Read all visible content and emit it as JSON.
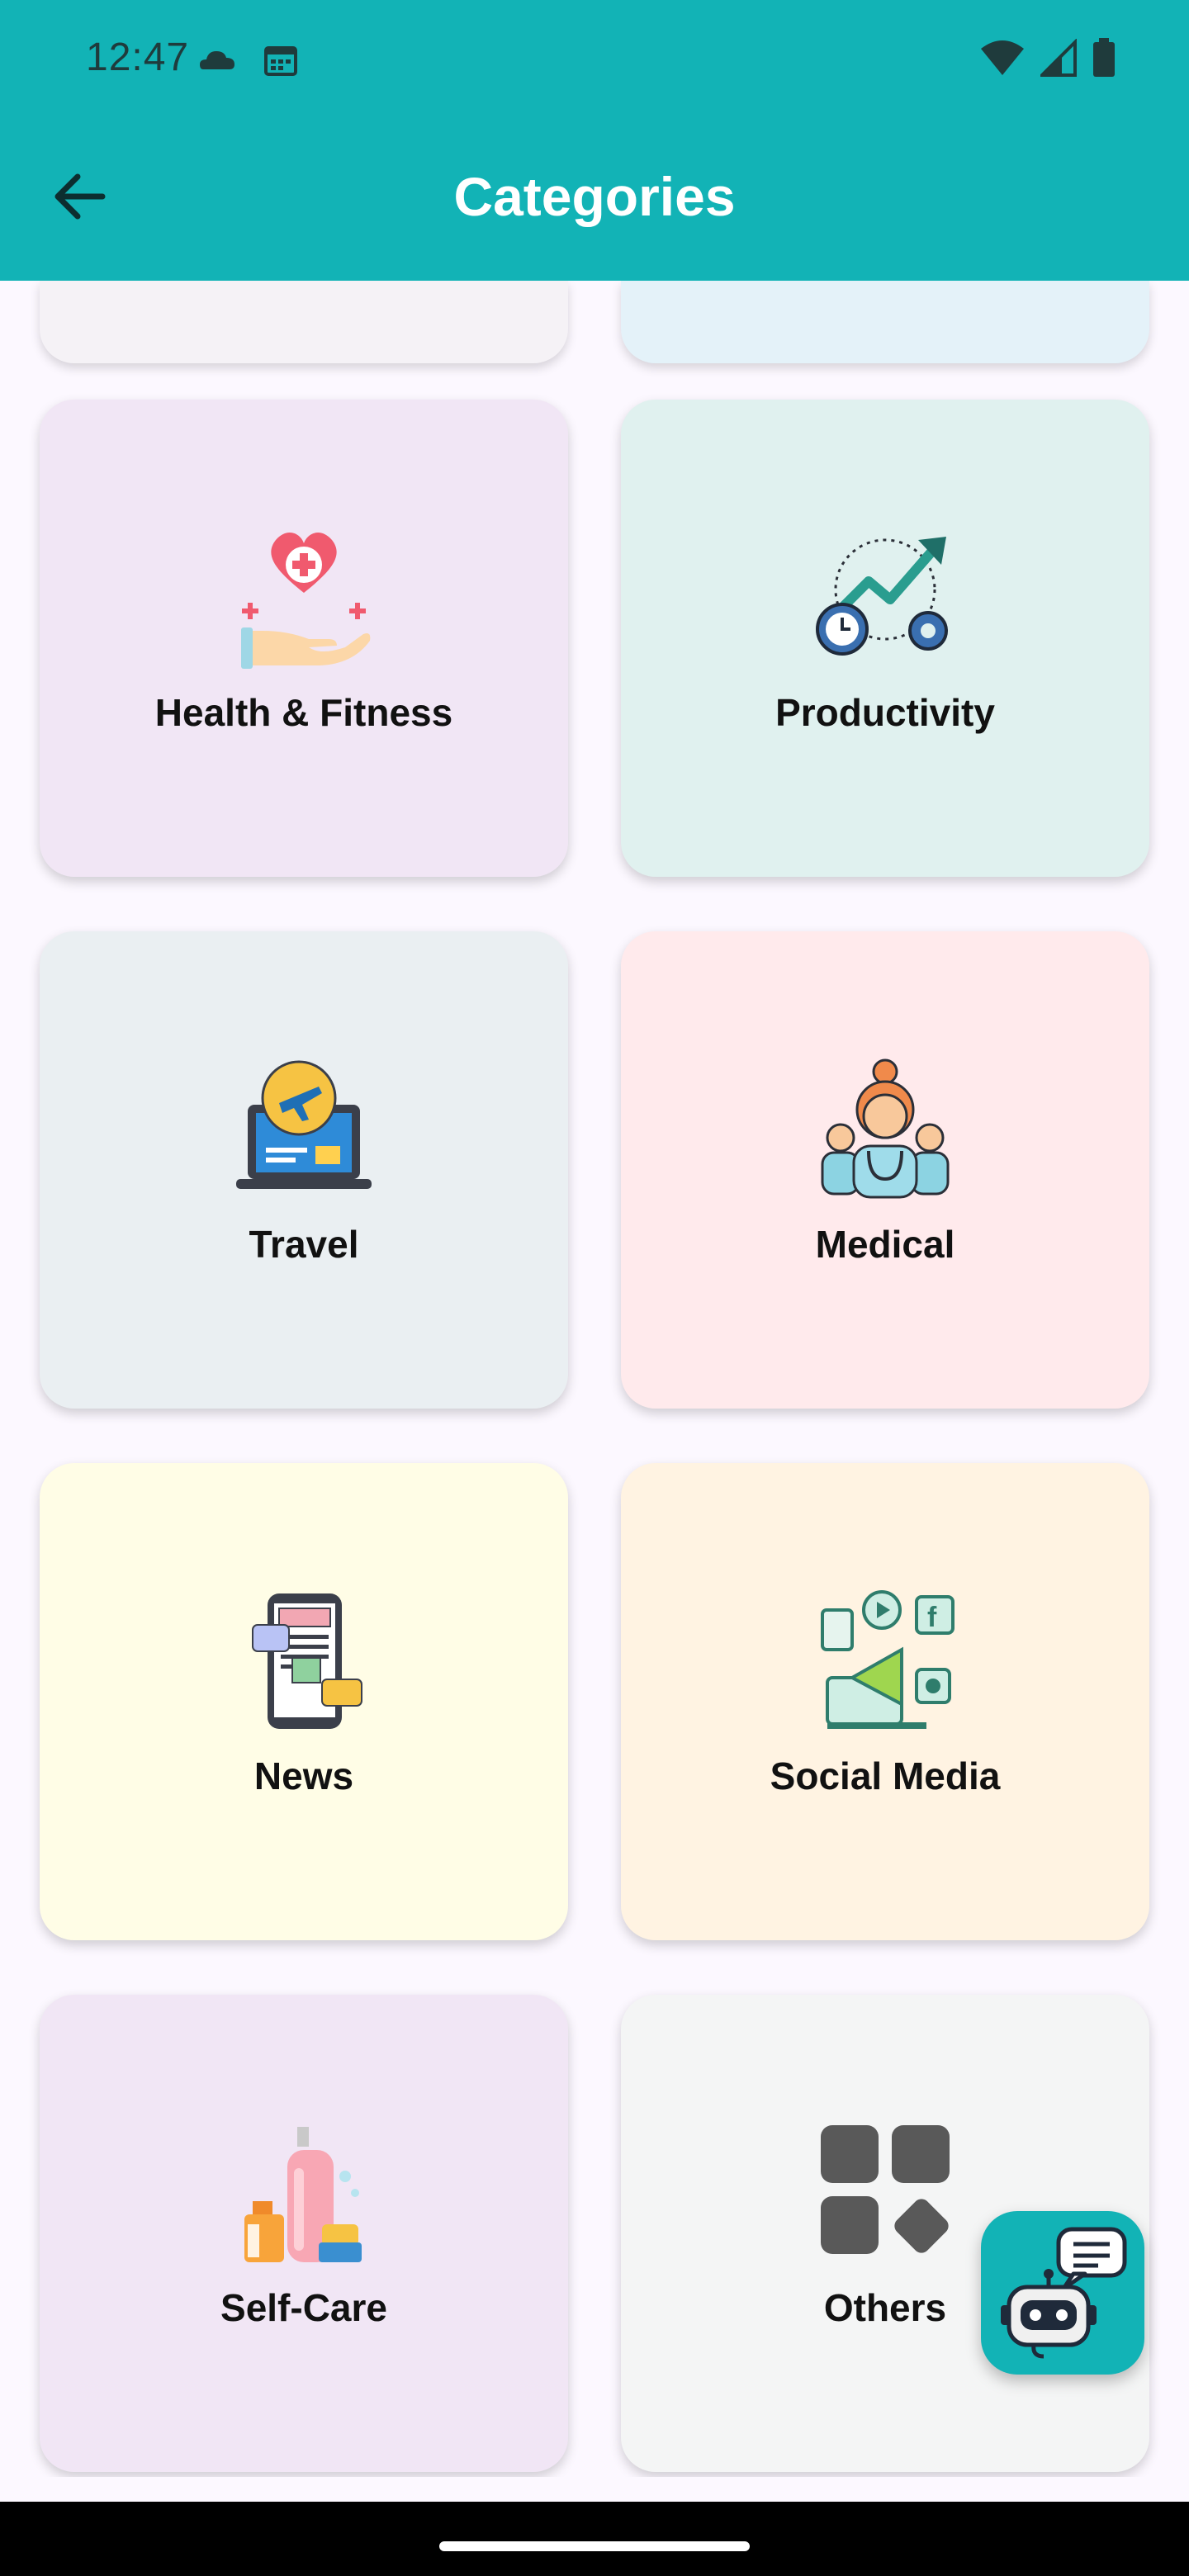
{
  "status_bar": {
    "time": "12:47"
  },
  "app_bar": {
    "title": "Categories"
  },
  "categories": [
    {
      "label": "Health & Fitness",
      "color": "#f1e6f5",
      "icon": "health-fitness-icon"
    },
    {
      "label": "Productivity",
      "color": "#e0f1ef",
      "icon": "productivity-icon"
    },
    {
      "label": "Travel",
      "color": "#eaeff2",
      "icon": "travel-icon"
    },
    {
      "label": "Medical",
      "color": "#ffeaec",
      "icon": "medical-icon"
    },
    {
      "label": "News",
      "color": "#fffde6",
      "icon": "news-icon"
    },
    {
      "label": "Social Media",
      "color": "#fff3e2",
      "icon": "social-media-icon"
    },
    {
      "label": "Self-Care",
      "color": "#f1e6f5",
      "icon": "self-care-icon"
    },
    {
      "label": "Others",
      "color": "#f4f5f5",
      "icon": "others-icon"
    }
  ],
  "colors": {
    "primary": "#12b3b6",
    "background": "#fcf8ff"
  }
}
